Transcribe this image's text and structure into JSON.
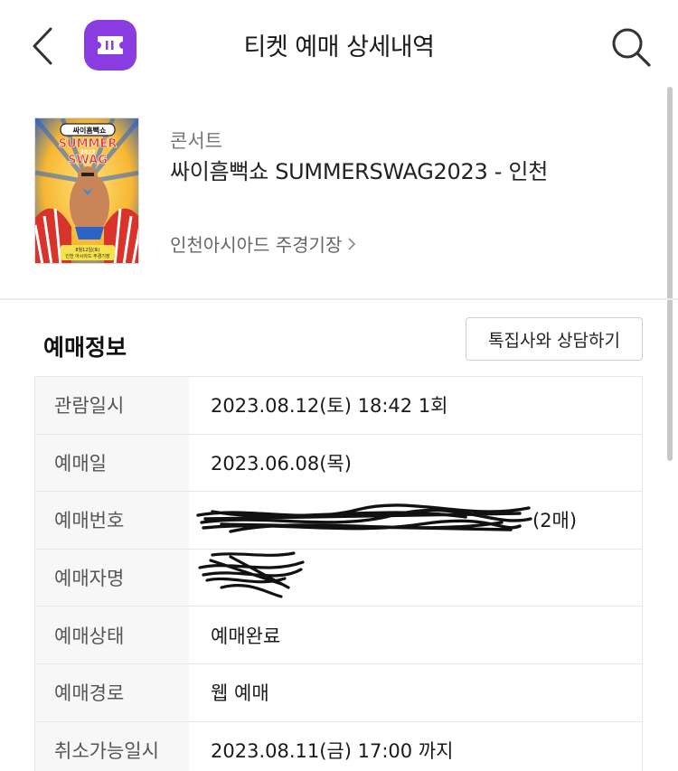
{
  "header": {
    "title": "티켓 예매 상세내역",
    "app_icon": "ticket-icon",
    "accent": "#8b3ce0"
  },
  "event": {
    "category": "콘서트",
    "title": "싸이흠뻑쇼 SUMMERSWAG2023 - 인천",
    "venue": "인천아시아드 주경기장",
    "poster": {
      "logo_text": "싸이흠뻑쇼",
      "headline_1": "SUMMER",
      "headline_2": "SWAG",
      "year": "2023",
      "date_text": "8월12일(토)",
      "venue_text": "인천 아시아드 주경기장"
    }
  },
  "reservation": {
    "section_title": "예매정보",
    "consult_button": "톡집사와 상담하기",
    "rows": [
      {
        "label": "관람일시",
        "value": "2023.08.12(토) 18:42 1회"
      },
      {
        "label": "예매일",
        "value": "2023.06.08(목)"
      },
      {
        "label": "예매번호",
        "value": "(2매)"
      },
      {
        "label": "예매자명",
        "value": ""
      },
      {
        "label": "예매상태",
        "value": "예매완료"
      },
      {
        "label": "예매경로",
        "value": "웹 예매"
      },
      {
        "label": "취소가능일시",
        "value": "2023.08.11(금) 17:00 까지"
      }
    ]
  }
}
